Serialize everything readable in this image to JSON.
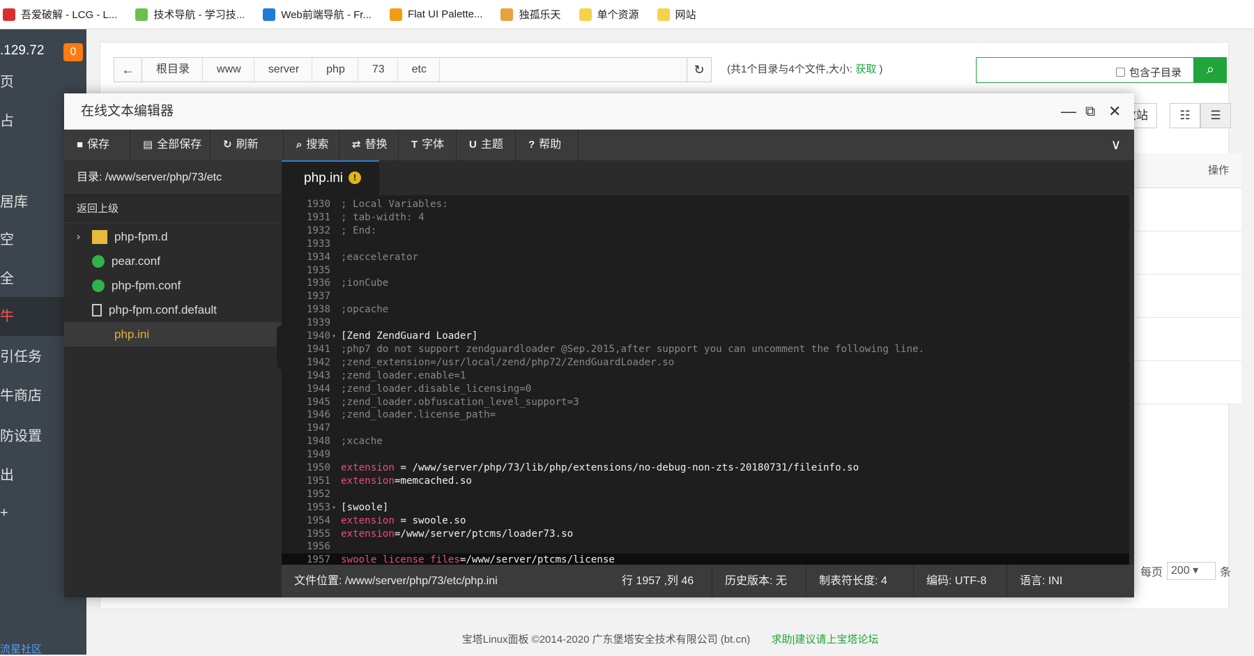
{
  "bookmarks": [
    {
      "label": "吾爱破解 - LCG - L...",
      "color": "#d9302f"
    },
    {
      "label": "技术导航 - 学习技...",
      "color": "#6cc04a"
    },
    {
      "label": "Web前端导航 - Fr...",
      "color": "#1f7bd8"
    },
    {
      "label": "Flat UI Palette...",
      "color": "#f39c12"
    },
    {
      "label": "独孤乐天",
      "color": "#e6a23c"
    },
    {
      "label": "单个资源",
      "color": "#f5d24b"
    },
    {
      "label": "网站",
      "color": "#f5d24b"
    }
  ],
  "sidebar": {
    "ip": ".129.72",
    "badge": "0",
    "items": [
      {
        "label": "页",
        "active": false
      },
      {
        "label": "占",
        "active": false
      },
      {
        "label": "居库",
        "active": false
      },
      {
        "label": "空",
        "active": false
      },
      {
        "label": "全",
        "active": false
      },
      {
        "label": "牛",
        "active": true
      },
      {
        "label": "引任务",
        "active": false
      },
      {
        "label": "牛商店",
        "active": false
      },
      {
        "label": "防设置",
        "active": false
      },
      {
        "label": "出",
        "active": false
      },
      {
        "label": "+",
        "active": false
      }
    ],
    "community": "流星社区"
  },
  "filemanager": {
    "breadcrumb": [
      "根目录",
      "www",
      "server",
      "php",
      "73",
      "etc"
    ],
    "dir_info_prefix": "(共1个目录与4个文件,大小:",
    "dir_info_link": "获取",
    "dir_info_suffix": ")",
    "include_subdir": "包含子目录",
    "partial_site_btn": "改站",
    "ops_header": "操作",
    "per_page_label": "每页",
    "per_page_value": "200",
    "per_page_unit": "条"
  },
  "footer": {
    "copyright": "宝塔Linux面板 ©2014-2020 广东堡塔安全技术有限公司 (bt.cn)",
    "forum": "求助|建议请上宝塔论坛"
  },
  "editor": {
    "title": "在线文本编辑器",
    "toolbar": [
      {
        "label": "保存",
        "icon": "save-icon"
      },
      {
        "label": "全部保存",
        "icon": "save-all-icon"
      },
      {
        "label": "刷新",
        "icon": "refresh-icon"
      },
      {
        "label": "搜索",
        "icon": "search-icon"
      },
      {
        "label": "替换",
        "icon": "replace-icon"
      },
      {
        "label": "字体",
        "icon": "font-icon"
      },
      {
        "label": "主题",
        "icon": "theme-icon"
      },
      {
        "label": "帮助",
        "icon": "help-icon"
      }
    ],
    "dir_label": "目录: /www/server/php/73/etc",
    "go_up": "返回上级",
    "files": [
      {
        "name": "php-fpm.d",
        "type": "folder",
        "selected": false
      },
      {
        "name": "pear.conf",
        "type": "conf",
        "selected": false
      },
      {
        "name": "php-fpm.conf",
        "type": "conf",
        "selected": false
      },
      {
        "name": "php-fpm.conf.default",
        "type": "text",
        "selected": false
      },
      {
        "name": "php.ini",
        "type": "ini",
        "selected": true
      }
    ],
    "tab": "php.ini",
    "code_lines": [
      {
        "n": "1930",
        "segs": [
          {
            "t": "; Local Variables:",
            "c": "com"
          }
        ]
      },
      {
        "n": "1931",
        "segs": [
          {
            "t": "; tab-width: 4",
            "c": "com"
          }
        ]
      },
      {
        "n": "1932",
        "segs": [
          {
            "t": "; End:",
            "c": "com"
          }
        ]
      },
      {
        "n": "1933",
        "segs": []
      },
      {
        "n": "1934",
        "segs": [
          {
            "t": ";eaccelerator",
            "c": "com"
          }
        ]
      },
      {
        "n": "1935",
        "segs": []
      },
      {
        "n": "1936",
        "segs": [
          {
            "t": ";ionCube",
            "c": "com"
          }
        ]
      },
      {
        "n": "1937",
        "segs": []
      },
      {
        "n": "1938",
        "segs": [
          {
            "t": ";opcache",
            "c": "com"
          }
        ]
      },
      {
        "n": "1939",
        "segs": []
      },
      {
        "n": "1940",
        "fold": true,
        "segs": [
          {
            "t": "[Zend ZendGuard Loader]",
            "c": "sec"
          }
        ]
      },
      {
        "n": "1941",
        "segs": [
          {
            "t": ";php7 do not support zendguardloader @Sep.2015,after support you can uncomment the following line.",
            "c": "com"
          }
        ]
      },
      {
        "n": "1942",
        "segs": [
          {
            "t": ";zend_extension=/usr/local/zend/php72/ZendGuardLoader.so",
            "c": "com"
          }
        ]
      },
      {
        "n": "1943",
        "segs": [
          {
            "t": ";zend_loader.enable=1",
            "c": "com"
          }
        ]
      },
      {
        "n": "1944",
        "segs": [
          {
            "t": ";zend_loader.disable_licensing=0",
            "c": "com"
          }
        ]
      },
      {
        "n": "1945",
        "segs": [
          {
            "t": ";zend_loader.obfuscation_level_support=3",
            "c": "com"
          }
        ]
      },
      {
        "n": "1946",
        "segs": [
          {
            "t": ";zend_loader.license_path=",
            "c": "com"
          }
        ]
      },
      {
        "n": "1947",
        "segs": []
      },
      {
        "n": "1948",
        "segs": [
          {
            "t": ";xcache",
            "c": "com"
          }
        ]
      },
      {
        "n": "1949",
        "segs": []
      },
      {
        "n": "1950",
        "segs": [
          {
            "t": "extension",
            "c": "key"
          },
          {
            "t": " = /www/server/php/73/lib/php/extensions/no-debug-non-zts-20180731/fileinfo.so",
            "c": "val"
          }
        ]
      },
      {
        "n": "1951",
        "segs": [
          {
            "t": "extension",
            "c": "key"
          },
          {
            "t": "=memcached.so",
            "c": "val"
          }
        ]
      },
      {
        "n": "1952",
        "segs": []
      },
      {
        "n": "1953",
        "fold": true,
        "segs": [
          {
            "t": "[swoole]",
            "c": "sec"
          }
        ]
      },
      {
        "n": "1954",
        "segs": [
          {
            "t": "extension",
            "c": "key"
          },
          {
            "t": " = swoole.so",
            "c": "val"
          }
        ]
      },
      {
        "n": "1955",
        "segs": [
          {
            "t": "extension",
            "c": "key"
          },
          {
            "t": "=/www/server/ptcms/loader73.so",
            "c": "val"
          }
        ]
      },
      {
        "n": "1956",
        "segs": []
      },
      {
        "n": "1957",
        "current": true,
        "segs": [
          {
            "t": "swoole_license_files",
            "c": "key"
          },
          {
            "t": "=/www/server/ptcms/license",
            "c": "val"
          }
        ]
      }
    ],
    "status": {
      "file_path": "文件位置: /www/server/php/73/etc/php.ini",
      "cursor": "行 1957 ,列 46",
      "history": "历史版本: 无",
      "tab_size": "制表符长度: 4",
      "encoding": "编码: UTF-8",
      "language": "语言: INI"
    }
  }
}
